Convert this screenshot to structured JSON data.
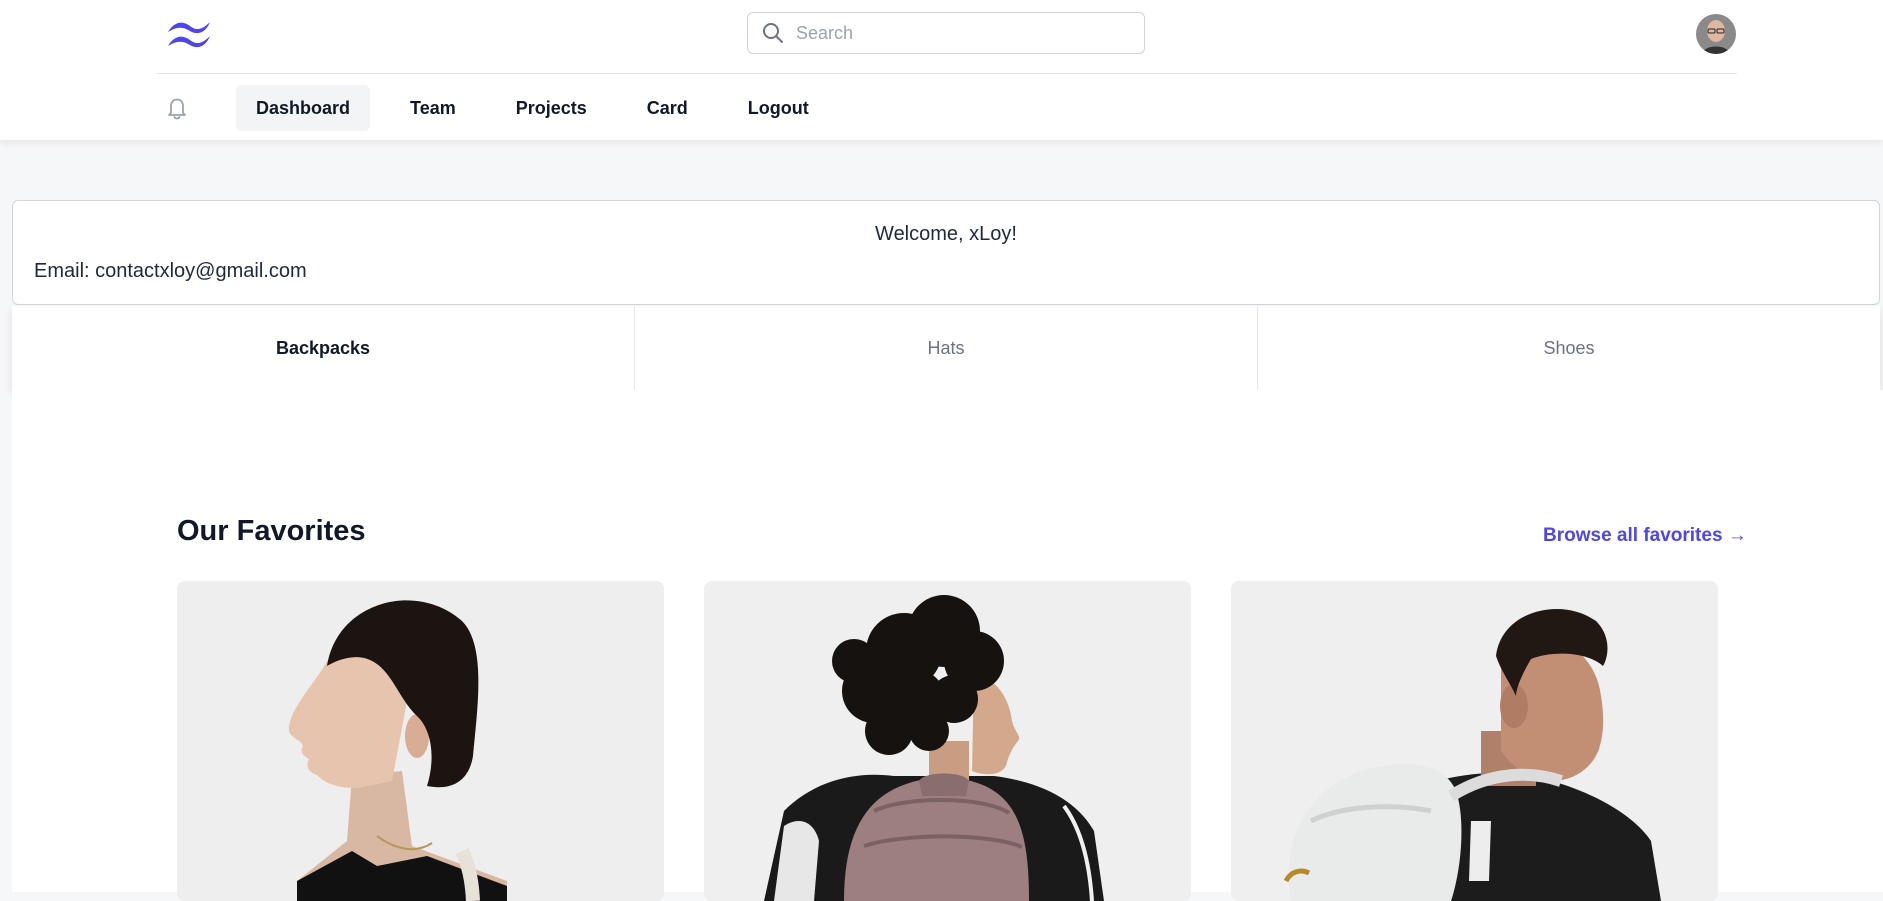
{
  "header": {
    "logo_icon": "tailwind-wave-logo",
    "search": {
      "placeholder": "Search",
      "value": ""
    },
    "avatar_alt": "User avatar"
  },
  "nav": {
    "notification_icon": "bell-icon",
    "items": [
      {
        "label": "Dashboard",
        "active": true
      },
      {
        "label": "Team",
        "active": false
      },
      {
        "label": "Projects",
        "active": false
      },
      {
        "label": "Card",
        "active": false
      },
      {
        "label": "Logout",
        "active": false
      }
    ]
  },
  "welcome": {
    "title": "Welcome, xLoy!",
    "email": "Email: contactxloy@gmail.com"
  },
  "tabs": [
    {
      "label": "Backpacks",
      "active": true
    },
    {
      "label": "Hats",
      "active": false
    },
    {
      "label": "Shoes",
      "active": false
    }
  ],
  "favorites": {
    "title": "Our Favorites",
    "browse_link": "Browse all favorites →",
    "products": [
      {
        "image": "woman-with-backpack"
      },
      {
        "image": "curly-hair-man-pink-backpack"
      },
      {
        "image": "man-white-backpack"
      }
    ]
  },
  "colors": {
    "accent": "#4f46e5",
    "logo": "#4f46e5",
    "page_bg": "#f6f7f9"
  }
}
